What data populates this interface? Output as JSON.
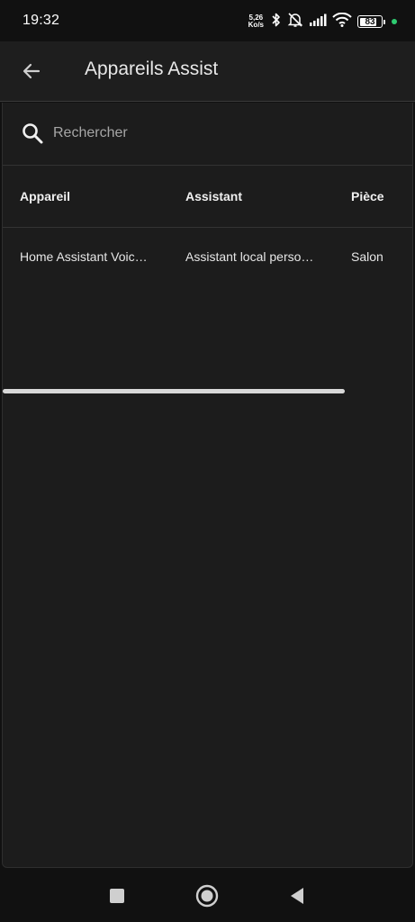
{
  "status_bar": {
    "time": "19:32",
    "net_speed_value": "5,26",
    "net_speed_unit": "Ko/s",
    "battery_level": "83",
    "battery_fraction": 0.83
  },
  "app_bar": {
    "title": "Appareils Assist"
  },
  "search": {
    "placeholder": "Rechercher",
    "value": ""
  },
  "table": {
    "columns": [
      "Appareil",
      "Assistant",
      "Pièce"
    ],
    "rows": [
      [
        "Home Assistant Voic…",
        "Assistant local perso…",
        "Salon"
      ]
    ]
  },
  "icons": {
    "back": "arrow-left-icon",
    "search": "search-icon",
    "nav_recents": "square-icon",
    "nav_home": "circle-icon",
    "nav_back": "triangle-back-icon"
  },
  "colors": {
    "background": "#111111",
    "surface": "#1c1c1c",
    "app_bar": "#1e1e1e",
    "indicator_green": "#2ecc71"
  }
}
